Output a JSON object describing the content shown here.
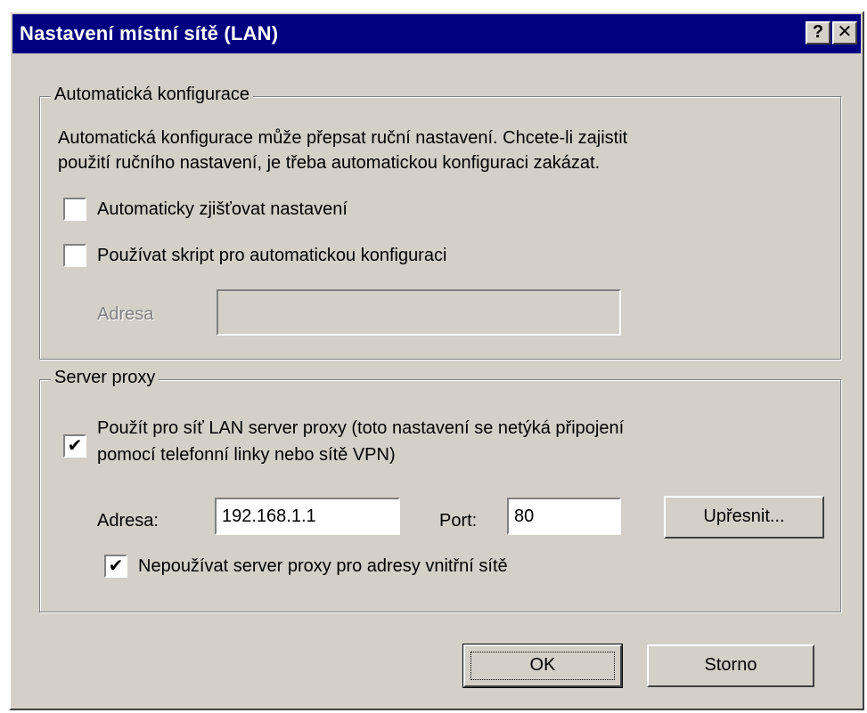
{
  "window": {
    "title": "Nastavení místní sítě (LAN)",
    "help_label": "?",
    "close_label": "✕"
  },
  "auto_config": {
    "legend": "Automatická konfigurace",
    "description_line1": "Automatická konfigurace může přepsat ruční nastavení. Chcete-li zajistit",
    "description_line2": "použití ručního nastavení, je třeba automatickou konfiguraci zakázat.",
    "detect_label": "Automaticky zjišťovat nastavení",
    "detect_checked": false,
    "script_label": "Používat skript pro automatickou konfiguraci",
    "script_checked": false,
    "address_label": "Adresa",
    "address_value": ""
  },
  "proxy": {
    "legend": "Server proxy",
    "use_proxy_line1": "Použít pro síť LAN server proxy (toto nastavení se netýká připojení",
    "use_proxy_line2": "pomocí telefonní linky nebo sítě VPN)",
    "use_proxy_checked": true,
    "address_label": "Adresa:",
    "address_value": "192.168.1.1",
    "port_label": "Port:",
    "port_value": "80",
    "advanced_label": "Upřesnit...",
    "bypass_label": "Nepoužívat server proxy pro adresy vnitřní sítě",
    "bypass_checked": true
  },
  "buttons": {
    "ok_label": "OK",
    "cancel_label": "Storno"
  },
  "check_mark": "✔"
}
